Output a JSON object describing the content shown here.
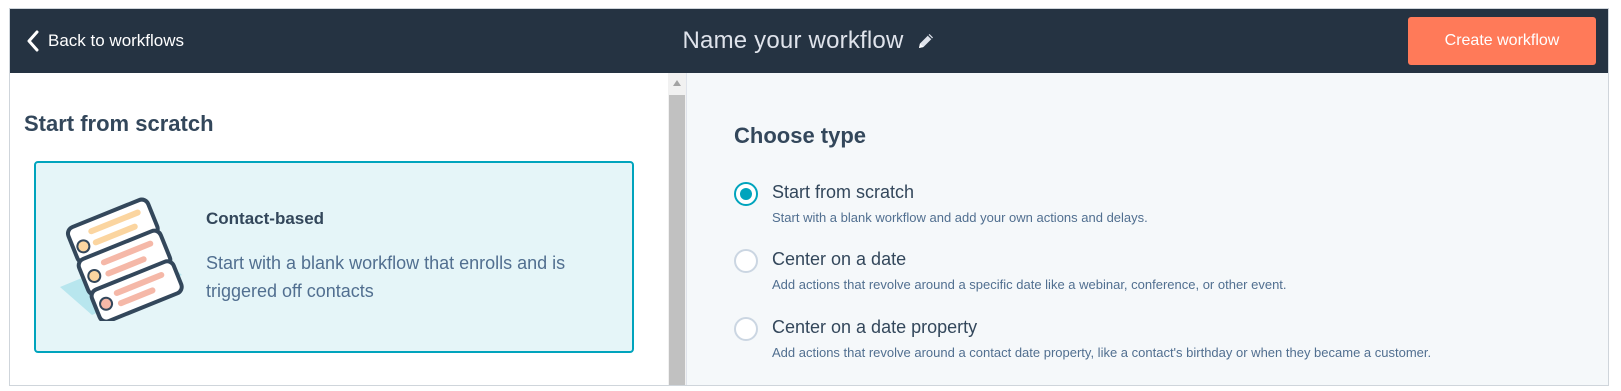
{
  "header": {
    "back_label": "Back to workflows",
    "title": "Name your workflow",
    "create_label": "Create workflow"
  },
  "left": {
    "heading": "Start from scratch",
    "card": {
      "title": "Contact-based",
      "description": "Start with a blank workflow that enrolls and is triggered off contacts",
      "illustration": "contact-workflow-illustration"
    }
  },
  "right": {
    "heading": "Choose type",
    "options": [
      {
        "label": "Start from scratch",
        "help": "Start with a blank workflow and add your own actions and delays.",
        "checked": true
      },
      {
        "label": "Center on a date",
        "help": "Add actions that revolve around a specific date like a webinar, conference, or other event.",
        "checked": false
      },
      {
        "label": "Center on a date property",
        "help": "Add actions that revolve around a contact date property, like a contact's birthday or when they became a customer.",
        "checked": false
      }
    ]
  },
  "colors": {
    "header_bg": "#253342",
    "accent": "#ff7a59",
    "selected": "#00a4bd",
    "card_bg": "#e5f5f8",
    "panel_bg": "#f5f8fa"
  },
  "icons": [
    "chevron-left-icon",
    "pencil-icon",
    "scroll-up-arrow-icon"
  ]
}
